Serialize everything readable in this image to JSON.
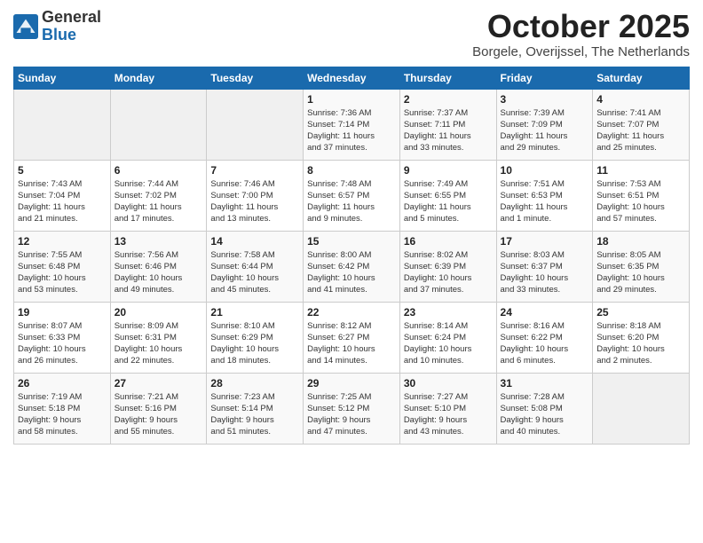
{
  "logo": {
    "general": "General",
    "blue": "Blue"
  },
  "title": "October 2025",
  "location": "Borgele, Overijssel, The Netherlands",
  "days_of_week": [
    "Sunday",
    "Monday",
    "Tuesday",
    "Wednesday",
    "Thursday",
    "Friday",
    "Saturday"
  ],
  "weeks": [
    [
      {
        "day": "",
        "content": ""
      },
      {
        "day": "",
        "content": ""
      },
      {
        "day": "",
        "content": ""
      },
      {
        "day": "1",
        "content": "Sunrise: 7:36 AM\nSunset: 7:14 PM\nDaylight: 11 hours\nand 37 minutes."
      },
      {
        "day": "2",
        "content": "Sunrise: 7:37 AM\nSunset: 7:11 PM\nDaylight: 11 hours\nand 33 minutes."
      },
      {
        "day": "3",
        "content": "Sunrise: 7:39 AM\nSunset: 7:09 PM\nDaylight: 11 hours\nand 29 minutes."
      },
      {
        "day": "4",
        "content": "Sunrise: 7:41 AM\nSunset: 7:07 PM\nDaylight: 11 hours\nand 25 minutes."
      }
    ],
    [
      {
        "day": "5",
        "content": "Sunrise: 7:43 AM\nSunset: 7:04 PM\nDaylight: 11 hours\nand 21 minutes."
      },
      {
        "day": "6",
        "content": "Sunrise: 7:44 AM\nSunset: 7:02 PM\nDaylight: 11 hours\nand 17 minutes."
      },
      {
        "day": "7",
        "content": "Sunrise: 7:46 AM\nSunset: 7:00 PM\nDaylight: 11 hours\nand 13 minutes."
      },
      {
        "day": "8",
        "content": "Sunrise: 7:48 AM\nSunset: 6:57 PM\nDaylight: 11 hours\nand 9 minutes."
      },
      {
        "day": "9",
        "content": "Sunrise: 7:49 AM\nSunset: 6:55 PM\nDaylight: 11 hours\nand 5 minutes."
      },
      {
        "day": "10",
        "content": "Sunrise: 7:51 AM\nSunset: 6:53 PM\nDaylight: 11 hours\nand 1 minute."
      },
      {
        "day": "11",
        "content": "Sunrise: 7:53 AM\nSunset: 6:51 PM\nDaylight: 10 hours\nand 57 minutes."
      }
    ],
    [
      {
        "day": "12",
        "content": "Sunrise: 7:55 AM\nSunset: 6:48 PM\nDaylight: 10 hours\nand 53 minutes."
      },
      {
        "day": "13",
        "content": "Sunrise: 7:56 AM\nSunset: 6:46 PM\nDaylight: 10 hours\nand 49 minutes."
      },
      {
        "day": "14",
        "content": "Sunrise: 7:58 AM\nSunset: 6:44 PM\nDaylight: 10 hours\nand 45 minutes."
      },
      {
        "day": "15",
        "content": "Sunrise: 8:00 AM\nSunset: 6:42 PM\nDaylight: 10 hours\nand 41 minutes."
      },
      {
        "day": "16",
        "content": "Sunrise: 8:02 AM\nSunset: 6:39 PM\nDaylight: 10 hours\nand 37 minutes."
      },
      {
        "day": "17",
        "content": "Sunrise: 8:03 AM\nSunset: 6:37 PM\nDaylight: 10 hours\nand 33 minutes."
      },
      {
        "day": "18",
        "content": "Sunrise: 8:05 AM\nSunset: 6:35 PM\nDaylight: 10 hours\nand 29 minutes."
      }
    ],
    [
      {
        "day": "19",
        "content": "Sunrise: 8:07 AM\nSunset: 6:33 PM\nDaylight: 10 hours\nand 26 minutes."
      },
      {
        "day": "20",
        "content": "Sunrise: 8:09 AM\nSunset: 6:31 PM\nDaylight: 10 hours\nand 22 minutes."
      },
      {
        "day": "21",
        "content": "Sunrise: 8:10 AM\nSunset: 6:29 PM\nDaylight: 10 hours\nand 18 minutes."
      },
      {
        "day": "22",
        "content": "Sunrise: 8:12 AM\nSunset: 6:27 PM\nDaylight: 10 hours\nand 14 minutes."
      },
      {
        "day": "23",
        "content": "Sunrise: 8:14 AM\nSunset: 6:24 PM\nDaylight: 10 hours\nand 10 minutes."
      },
      {
        "day": "24",
        "content": "Sunrise: 8:16 AM\nSunset: 6:22 PM\nDaylight: 10 hours\nand 6 minutes."
      },
      {
        "day": "25",
        "content": "Sunrise: 8:18 AM\nSunset: 6:20 PM\nDaylight: 10 hours\nand 2 minutes."
      }
    ],
    [
      {
        "day": "26",
        "content": "Sunrise: 7:19 AM\nSunset: 5:18 PM\nDaylight: 9 hours\nand 58 minutes."
      },
      {
        "day": "27",
        "content": "Sunrise: 7:21 AM\nSunset: 5:16 PM\nDaylight: 9 hours\nand 55 minutes."
      },
      {
        "day": "28",
        "content": "Sunrise: 7:23 AM\nSunset: 5:14 PM\nDaylight: 9 hours\nand 51 minutes."
      },
      {
        "day": "29",
        "content": "Sunrise: 7:25 AM\nSunset: 5:12 PM\nDaylight: 9 hours\nand 47 minutes."
      },
      {
        "day": "30",
        "content": "Sunrise: 7:27 AM\nSunset: 5:10 PM\nDaylight: 9 hours\nand 43 minutes."
      },
      {
        "day": "31",
        "content": "Sunrise: 7:28 AM\nSunset: 5:08 PM\nDaylight: 9 hours\nand 40 minutes."
      },
      {
        "day": "",
        "content": ""
      }
    ]
  ]
}
